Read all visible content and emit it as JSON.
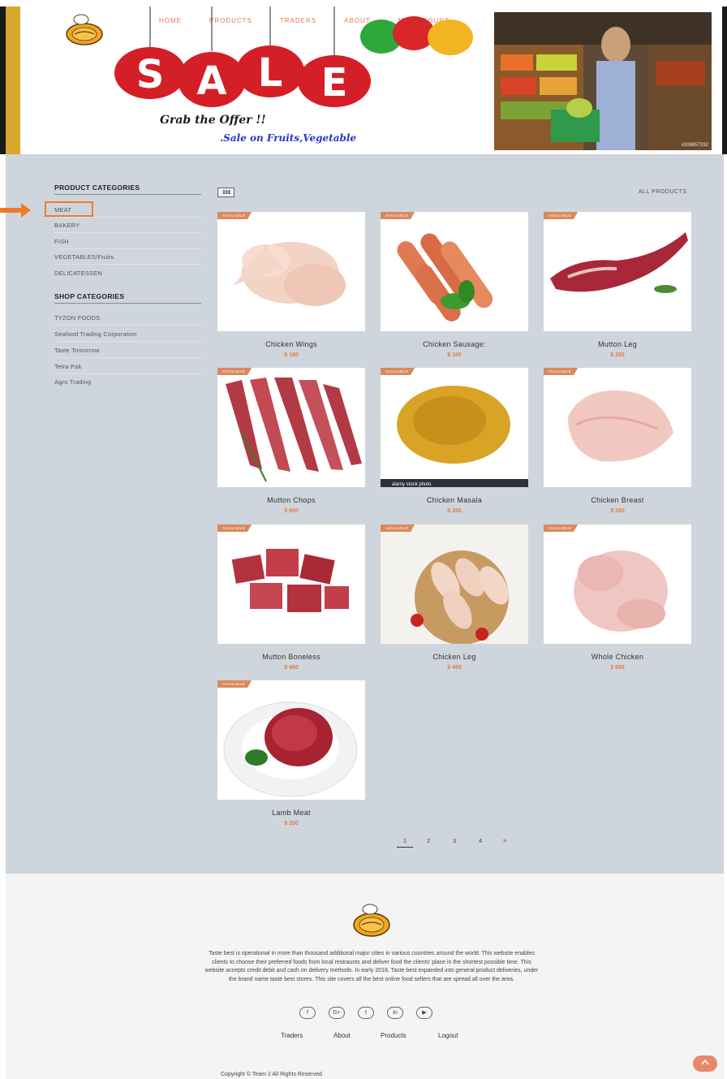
{
  "header": {
    "nav": [
      "HOME",
      "PRODUCTS",
      "TRADERS",
      "ABOUT",
      "MY ACCOUNT"
    ],
    "banner_word": [
      "S",
      "A",
      "L",
      "E"
    ],
    "grab_text": "Grab the Offer !!",
    "sale_text": ".Sale on Fruits,Vegetable",
    "photo_id": "#206857332"
  },
  "sidebar": {
    "product_heading": "PRODUCT CATEGORIES",
    "product_items": [
      "MEAT",
      "BAKERY",
      "FISH",
      "VEGETABLES/Fruits",
      "DELICATESSEN"
    ],
    "shop_heading": "SHOP CATEGORIES",
    "shop_items": [
      "TYZON FOODS",
      "Seafood Trading Corporation",
      "Taste Tomorrow",
      "Tetra Pak",
      "Agro Trading"
    ]
  },
  "toolbar": {
    "all_products": "ALL PRODUCTS"
  },
  "badge_label": "AVAILABLE",
  "products": [
    {
      "name": "Chicken Wings",
      "price": "$ 180",
      "image": "chicken-wings"
    },
    {
      "name": "Chicken Sausage:",
      "price": "$ 100",
      "image": "sausage"
    },
    {
      "name": "Mutton Leg",
      "price": "$ 250",
      "image": "mutton-leg"
    },
    {
      "name": "Mutton Chops",
      "price": "$ 600",
      "image": "mutton-chops"
    },
    {
      "name": "Chicken Masala",
      "price": "$ 260",
      "image": "masala"
    },
    {
      "name": "Chicken Breast",
      "price": "$ 260",
      "image": "chicken-breast"
    },
    {
      "name": "Mutton Boneless",
      "price": "$ 460",
      "image": "mutton-boneless"
    },
    {
      "name": "Chicken Leg",
      "price": "$ 460",
      "image": "chicken-leg"
    },
    {
      "name": "Whole Chicken",
      "price": "$ 660",
      "image": "whole-chicken"
    },
    {
      "name": "Lamb Meat",
      "price": "$ 200",
      "image": "lamb-meat"
    }
  ],
  "stock_photo_label": "alamy stock photo",
  "pagination": [
    "1",
    "2",
    "3",
    "4",
    ">"
  ],
  "footer": {
    "about": "Taste best is operational in more than thousand additional major cities in various countries around the world. This website enables clients to choose their preferred foods from local restraunts and deliver food the clients' place in the shortest possible time. This website accepts credit debit and cash on delivery methods. In early 2018, Taste best expanded into general product deliveries, under the brand name taste best stores. This site covers all the best online food sellers that are spread all over the area.",
    "socials": [
      "f",
      "G+",
      "t",
      "in",
      "▶"
    ],
    "links": [
      "Traders",
      "About",
      "Products",
      "Logout"
    ],
    "copyright": "Copyright © Team 2 All Rights Reserved"
  }
}
